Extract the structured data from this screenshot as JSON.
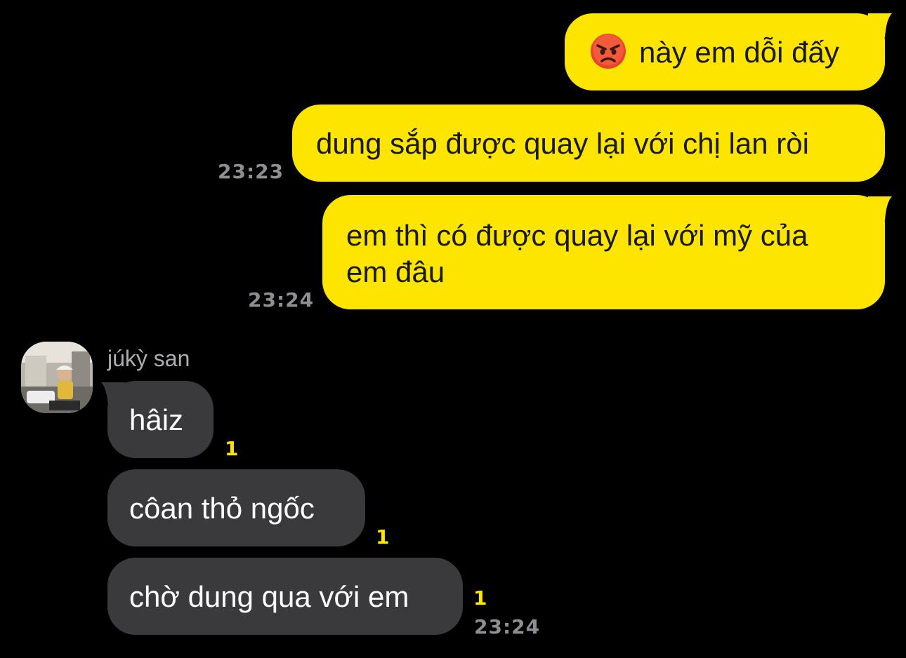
{
  "conversation": {
    "outgoing": [
      {
        "emoji": "angry-face",
        "text": "này em dỗi đấy",
        "time": ""
      },
      {
        "text": "dung sắp được quay lại với chị lan ròi",
        "time": "23:23"
      },
      {
        "text_line1": "em thì có được quay lại với mỹ của",
        "text_line2": "em đâu",
        "time": "23:24"
      }
    ],
    "incoming_sender": {
      "name": "júkỳ san",
      "avatar": "profile-photo"
    },
    "incoming": [
      {
        "text": "hâiz",
        "unread": "1",
        "time": ""
      },
      {
        "text": "côan thỏ ngốc",
        "unread": "1",
        "time": ""
      },
      {
        "text": "chờ dung qua với em",
        "unread": "1",
        "time": "23:24"
      }
    ]
  },
  "colors": {
    "background": "#000000",
    "outgoing_bubble": "#FEE500",
    "incoming_bubble": "#3A3A3C",
    "unread": "#FEE500",
    "timestamp": "#8E8E93"
  }
}
